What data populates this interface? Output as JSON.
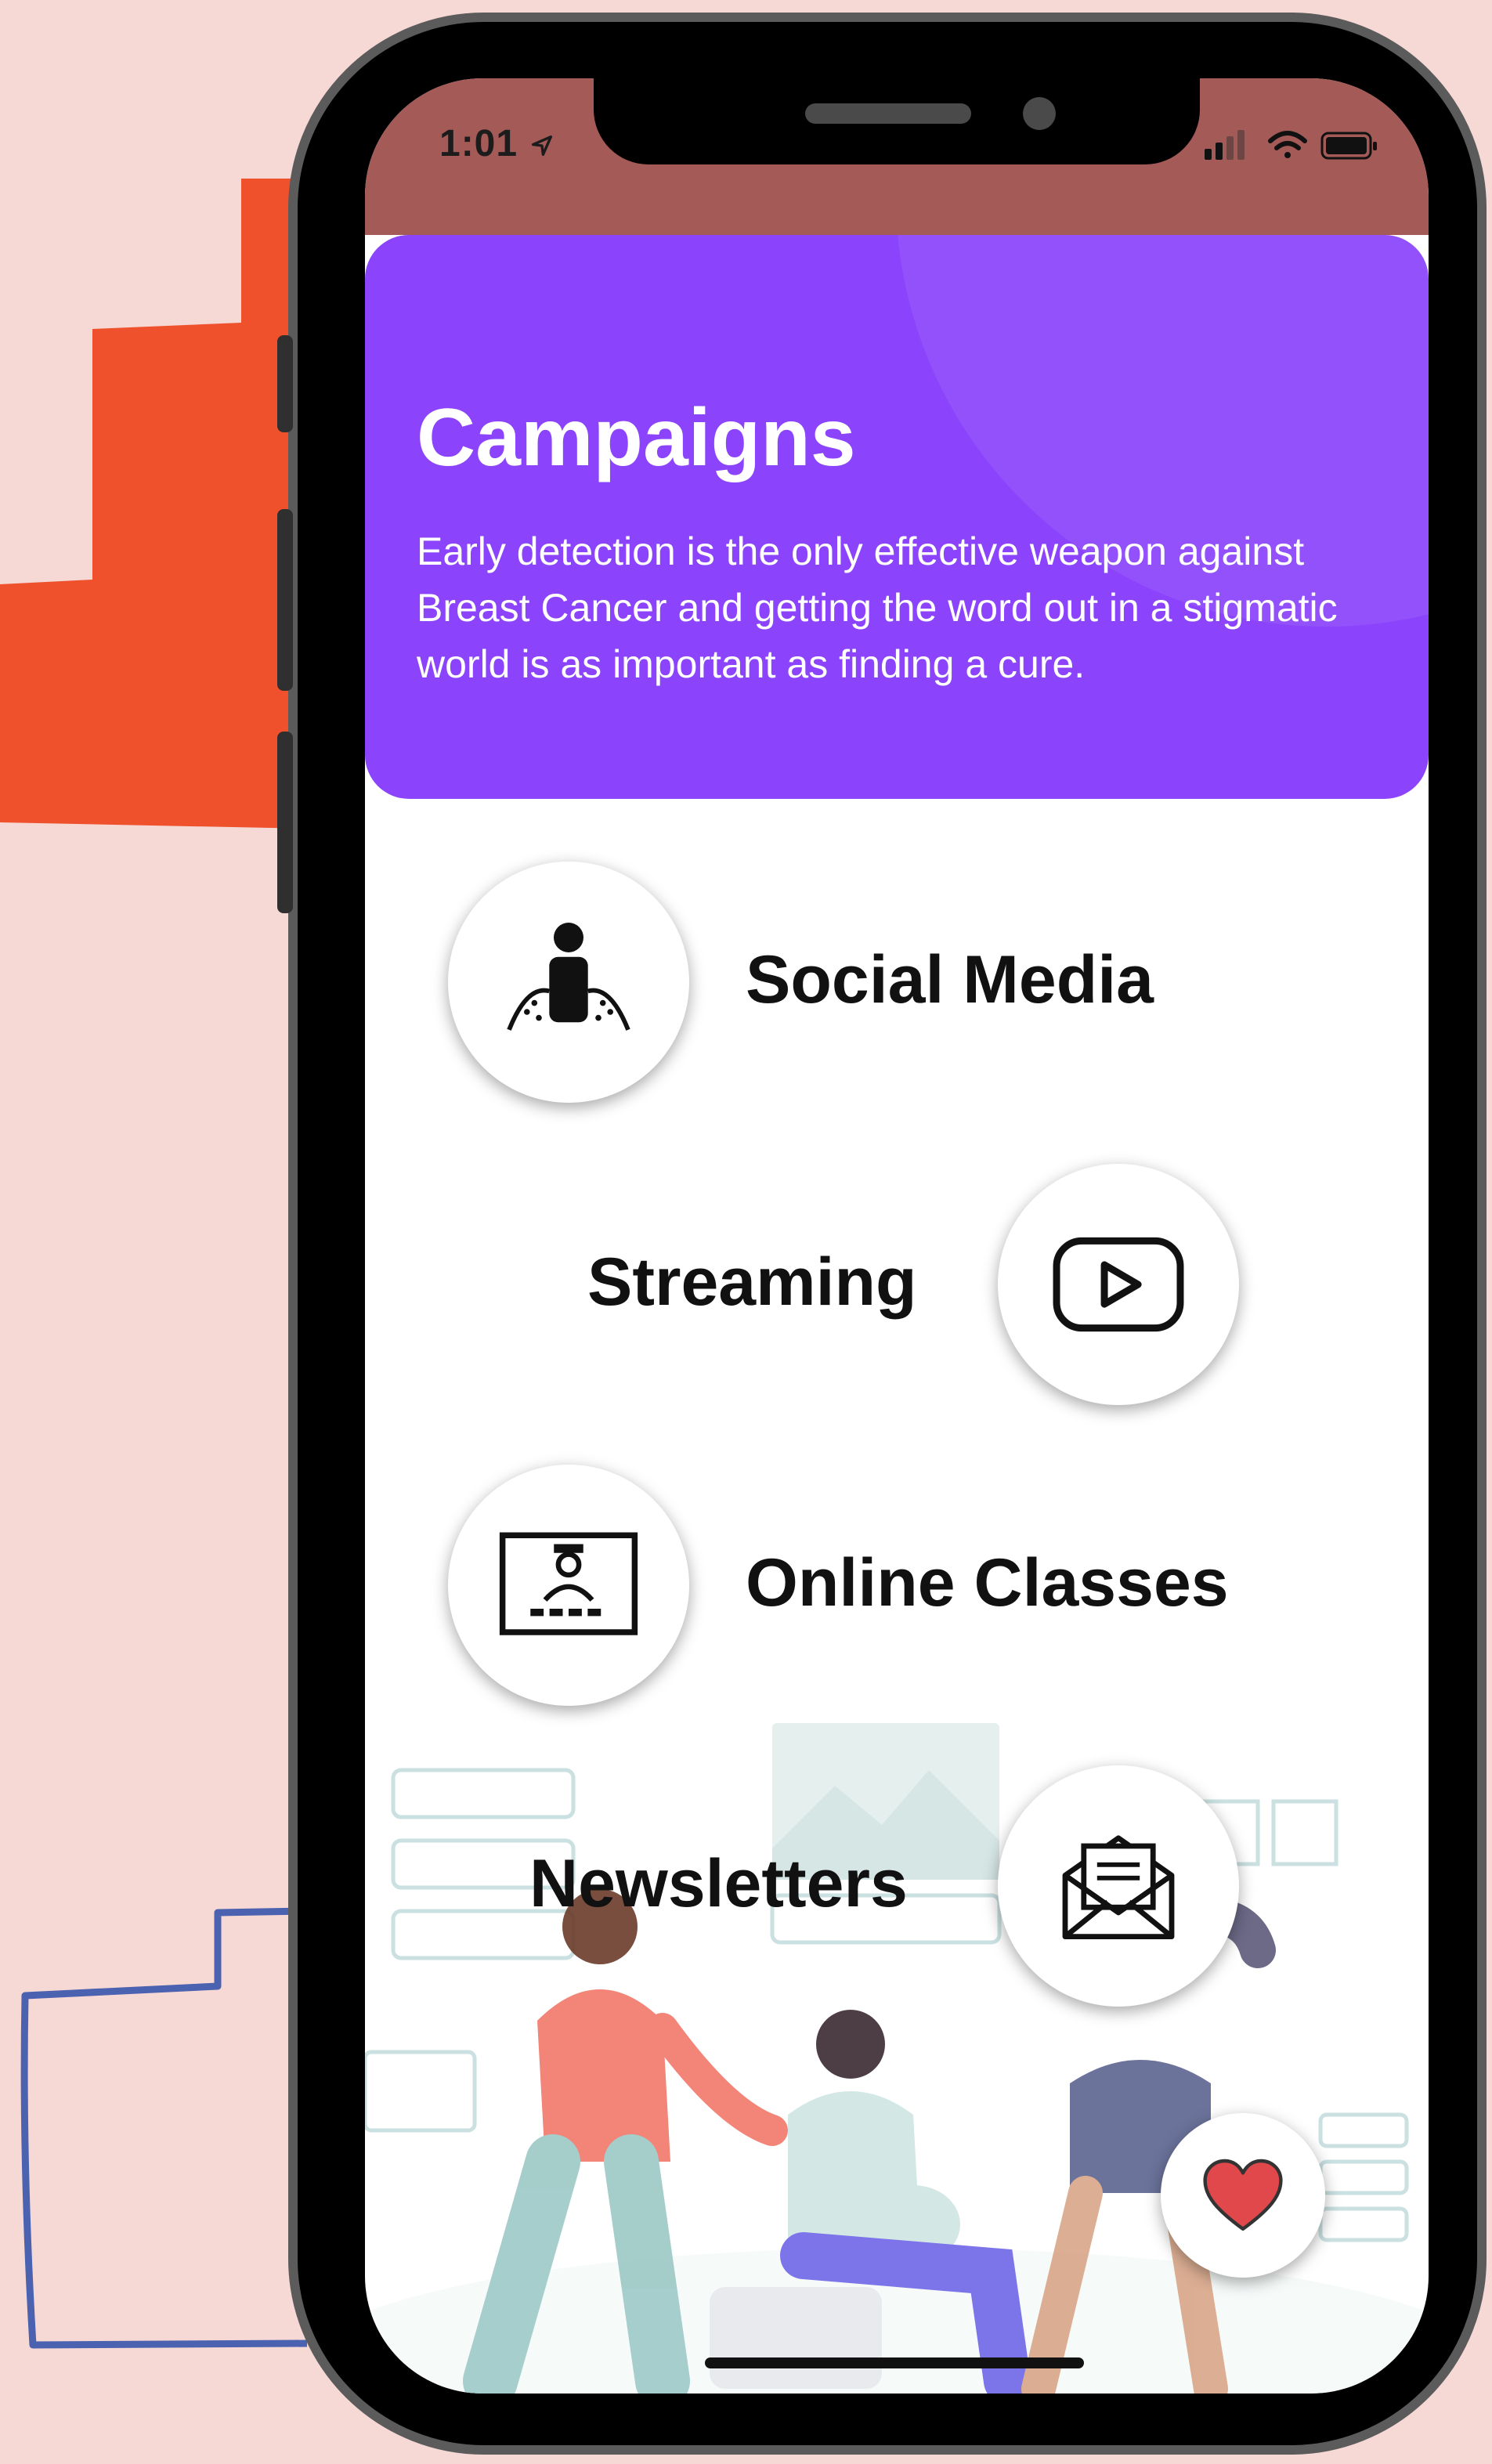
{
  "status_bar": {
    "time": "1:01"
  },
  "header": {
    "title": "Campaigns",
    "description": "Early detection is the only effective weapon against Breast Cancer and getting the word out in a stigmatic world is as important as finding a cure."
  },
  "menu": [
    {
      "label": "Social Media",
      "icon": "person-speaker-icon"
    },
    {
      "label": "Streaming",
      "icon": "play-video-icon"
    },
    {
      "label": "Online Classes",
      "icon": "online-teacher-icon"
    },
    {
      "label": "Newsletters",
      "icon": "envelope-letter-icon"
    }
  ],
  "fab": {
    "icon": "heart-icon"
  },
  "colors": {
    "background": "#f6d8d4",
    "header": "#8b44fb",
    "status_bar": "#a45a57",
    "accent_orange": "#ef512d",
    "accent_blue": "#4a62b0",
    "heart": "#e0484b"
  }
}
